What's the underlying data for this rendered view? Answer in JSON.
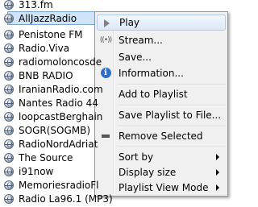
{
  "playlist": {
    "items": [
      {
        "label": "313.fm"
      },
      {
        "label": "AllJazzRadio",
        "selected": true
      },
      {
        "label": "Penistone FM"
      },
      {
        "label": "Radio.Viva"
      },
      {
        "label": "radiomoloncosde"
      },
      {
        "label": "BNB RADIO"
      },
      {
        "label": "IranianRadio.com"
      },
      {
        "label": "Nantes Radio 44"
      },
      {
        "label": "loopcastBerghain"
      },
      {
        "label": "SOGR(SOGMB)"
      },
      {
        "label": "RadioNordAdriat"
      },
      {
        "label": "The Source"
      },
      {
        "label": "i91now"
      },
      {
        "label": "MemoriesradioFl"
      },
      {
        "label": "Radio La96.1 (MP3)"
      }
    ]
  },
  "context_menu": {
    "play": "Play",
    "stream": "Stream...",
    "save": "Save...",
    "information": "Information...",
    "add_to_playlist": "Add to Playlist",
    "save_playlist": "Save Playlist to File...",
    "remove_selected": "Remove Selected",
    "sort_by": "Sort by",
    "display_size": "Display size",
    "playlist_view_mode": "Playlist View Mode",
    "stream_icon_glyph": "((•))",
    "info_icon_glyph": "i"
  },
  "colors": {
    "selection_bg": "#cfe4f8",
    "selection_border": "#7aa7d6",
    "menu_bg": "#f0f0f0",
    "menu_hover": "#dbe8f8",
    "info_icon": "#2f6fce"
  }
}
